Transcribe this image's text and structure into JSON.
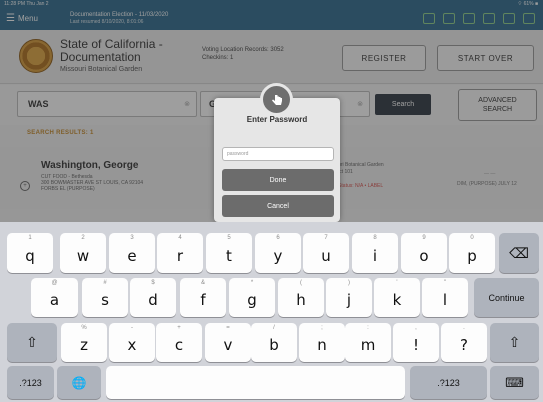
{
  "status_bar": {
    "time": "11:28 PM  Thu Jan 2",
    "battery": "⌔ 61% ■"
  },
  "top_bar": {
    "menu_label": "Menu",
    "title": "Documentation Election - 11/03/2020",
    "subtitle": "Last resumed 8/10/2020, 8:01:06"
  },
  "header": {
    "org_title_line1": "State of California -",
    "org_title_line2": "Documentation",
    "location": "Missouri Botanical Garden",
    "voting_line1": "Voting Location Records: 3052",
    "voting_line2": "Checkins: 1",
    "register_label": "REGISTER",
    "startover_label": "START OVER"
  },
  "search": {
    "last_name_value": "WAS",
    "first_name_value": "G",
    "search_label": "Search",
    "advanced_label_line1": "ADVANCED",
    "advanced_label_line2": "SEARCH"
  },
  "results": {
    "count_label": "SEARCH RESULTS: 1",
    "row": {
      "name": "Washington, George",
      "addr_line1": "CUT FOOD - Bethesda",
      "addr_line2": "300 BOWMASTER AVE ST LOUIS, CA 92104",
      "addr_line3": "FORBS EL (PURPOSE)",
      "poll_line1": "Missouri Botanical Garden",
      "poll_line2": "Precinct 101",
      "status": "Voter Status: N/A • LABEL",
      "right_text": "DIM, (PURPOSE) JULY 12",
      "right_text2": "— —"
    }
  },
  "dialog": {
    "title": "Enter Password",
    "placeholder": "password",
    "done_label": "Done",
    "cancel_label": "Cancel"
  },
  "keyboard": {
    "row1": [
      {
        "main": "q",
        "sub": "1"
      },
      {
        "main": "w",
        "sub": "2"
      },
      {
        "main": "e",
        "sub": "3"
      },
      {
        "main": "r",
        "sub": "4"
      },
      {
        "main": "t",
        "sub": "5"
      },
      {
        "main": "y",
        "sub": "6"
      },
      {
        "main": "u",
        "sub": "7"
      },
      {
        "main": "i",
        "sub": "8"
      },
      {
        "main": "o",
        "sub": "9"
      },
      {
        "main": "p",
        "sub": "0"
      }
    ],
    "backspace": "⌫",
    "row2": [
      {
        "main": "a",
        "sub": "@"
      },
      {
        "main": "s",
        "sub": "#"
      },
      {
        "main": "d",
        "sub": "$"
      },
      {
        "main": "f",
        "sub": "&"
      },
      {
        "main": "g",
        "sub": "*"
      },
      {
        "main": "h",
        "sub": "("
      },
      {
        "main": "j",
        "sub": ")"
      },
      {
        "main": "k",
        "sub": "'"
      },
      {
        "main": "l",
        "sub": "\""
      }
    ],
    "continue_label": "Continue",
    "shift": "⇧",
    "row3": [
      {
        "main": "z",
        "sub": "%"
      },
      {
        "main": "x",
        "sub": "-"
      },
      {
        "main": "c",
        "sub": "+"
      },
      {
        "main": "v",
        "sub": "="
      },
      {
        "main": "b",
        "sub": "/"
      },
      {
        "main": "n",
        "sub": ";"
      },
      {
        "main": "m",
        "sub": ":"
      },
      {
        "main": "!",
        "sub": ","
      },
      {
        "main": "?",
        "sub": "."
      }
    ],
    "numbers_label": ".?123",
    "globe": "🌐",
    "hide_keyboard": "⌨"
  }
}
